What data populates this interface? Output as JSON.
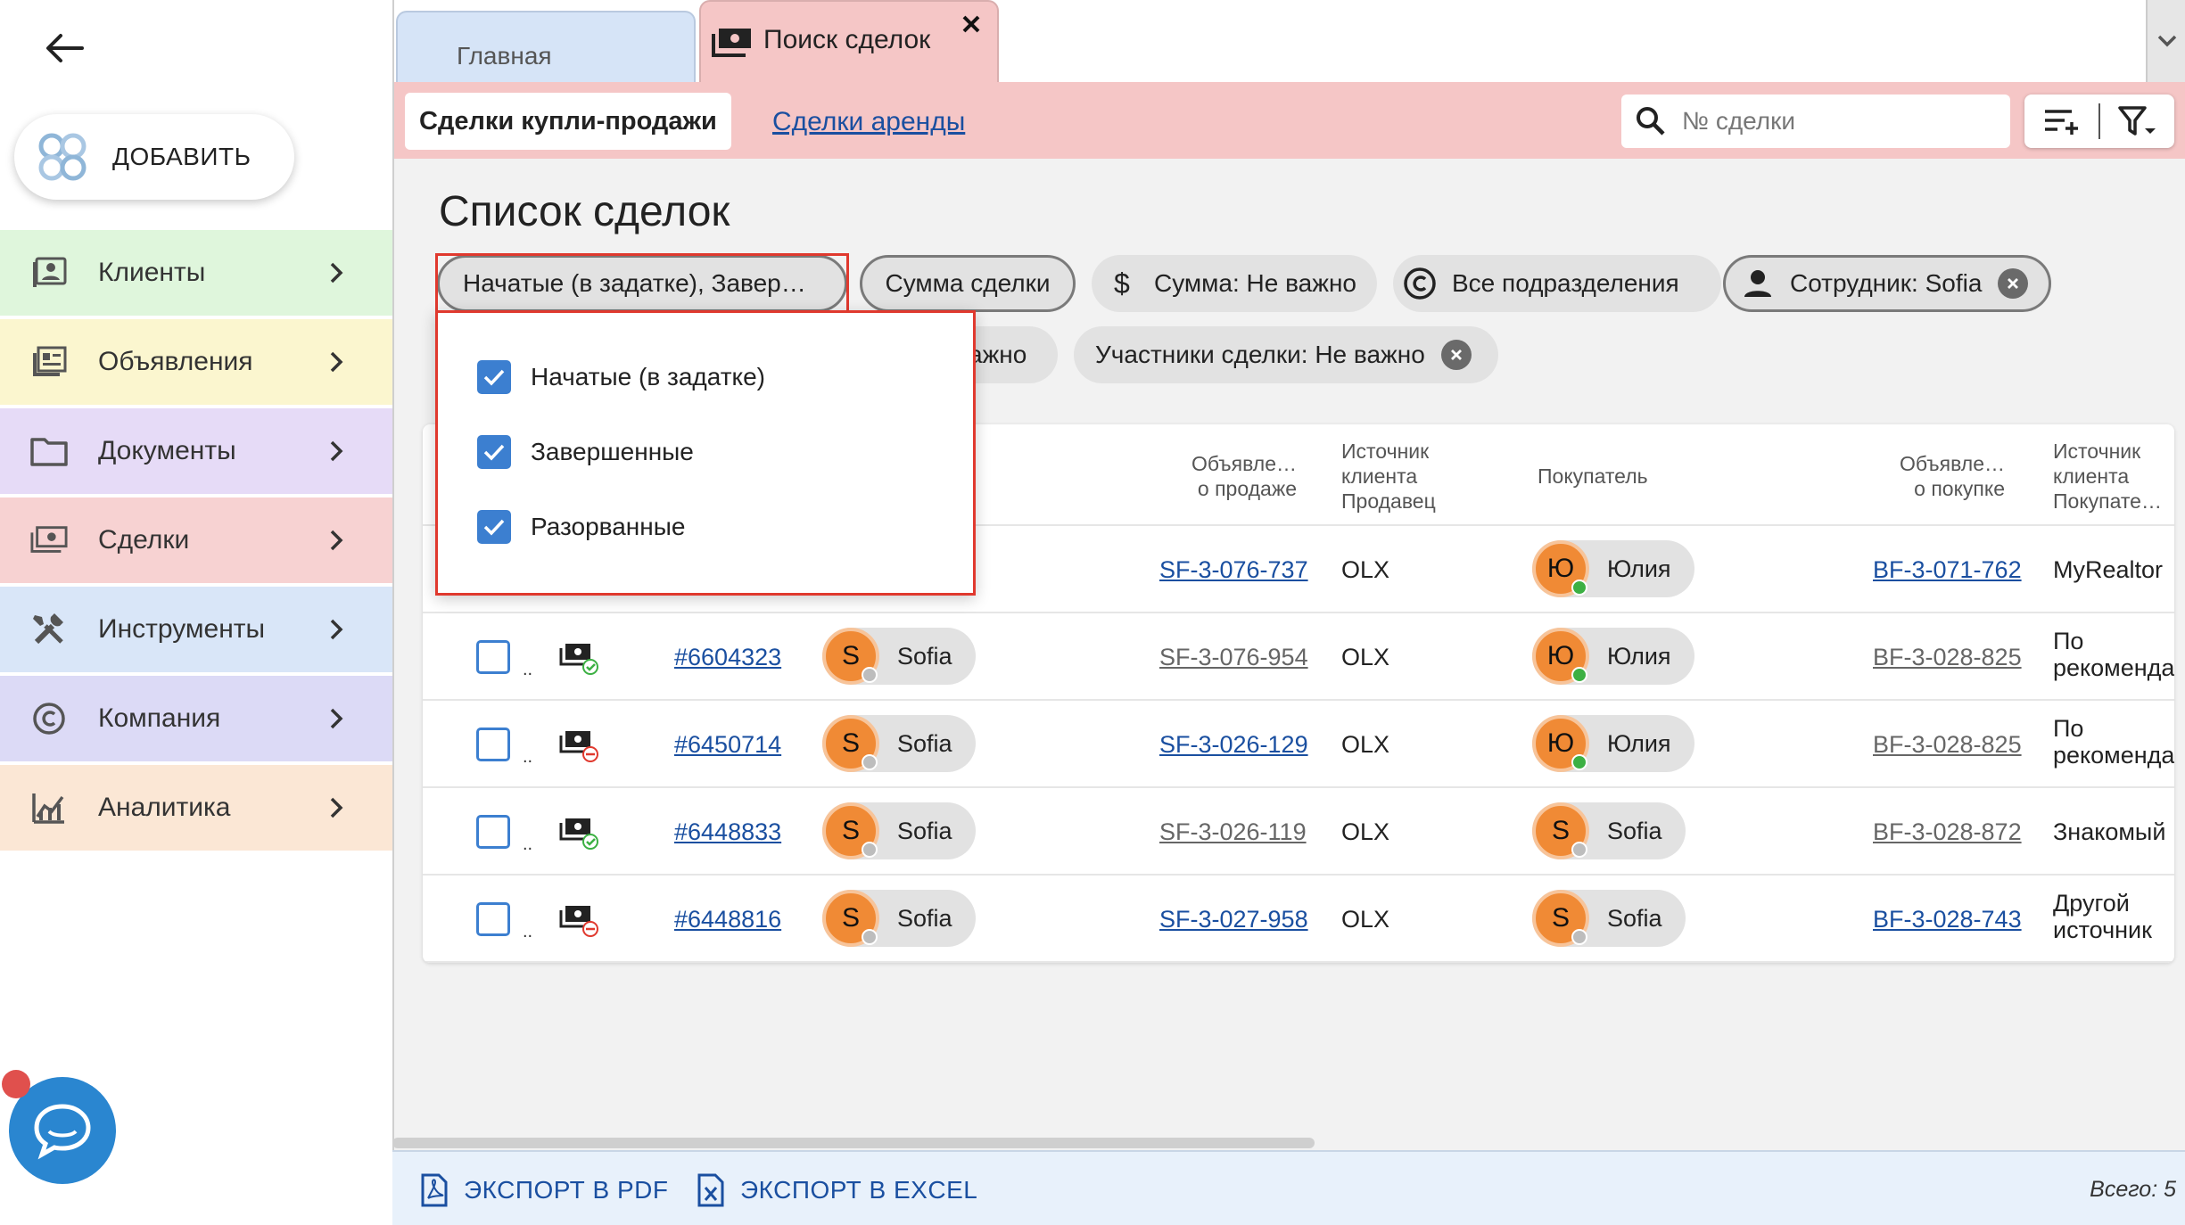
{
  "sidebar": {
    "add_label": "ДОБАВИТЬ",
    "items": [
      {
        "label": "Клиенты",
        "icon": "contacts-icon",
        "color": "#dff6dc"
      },
      {
        "label": "Объявления",
        "icon": "listings-icon",
        "color": "#fbf6cf"
      },
      {
        "label": "Документы",
        "icon": "folder-icon",
        "color": "#e6dbf7"
      },
      {
        "label": "Сделки",
        "icon": "money-icon",
        "color": "#f7d2d2"
      },
      {
        "label": "Инструменты",
        "icon": "tools-icon",
        "color": "#d9e6f8"
      },
      {
        "label": "Компания",
        "icon": "copyright-icon",
        "color": "#dcdaf6"
      },
      {
        "label": "Аналитика",
        "icon": "analytics-icon",
        "color": "#fbe7d5"
      }
    ]
  },
  "tabs": {
    "home": "Главная",
    "search": "Поиск сделок"
  },
  "subbar": {
    "active": "Сделки купли-продажи",
    "link": "Сделки аренды",
    "search_placeholder": "№ сделки"
  },
  "page_title": "Список сделок",
  "chips": {
    "status": "Начатые (в задатке), Завер…",
    "sum_deal": "Сумма сделки",
    "sum": "Сумма: Не важно",
    "departments": "Все подразделения",
    "employee": "Сотрудник: Sofia",
    "hidden_partial": "ажно",
    "participants": "Участники сделки: Не важно"
  },
  "dropdown": {
    "items": [
      "Начатые (в задатке)",
      "Завершенные",
      "Разорванные"
    ]
  },
  "table": {
    "headers": {
      "listing_sale": [
        "Объявле…",
        "о продаже"
      ],
      "source_seller": [
        "Источник",
        "клиента",
        "Продавец"
      ],
      "buyer": "Покупатель",
      "listing_buy": [
        "Объявле…",
        "о покупке"
      ],
      "source_buyer": [
        "Источник",
        "клиента",
        "Покупате…"
      ]
    },
    "rows": [
      {
        "id": "",
        "status": "",
        "agent": "",
        "listing_sale": "SF-3-076-737",
        "listing_sale_style": "blue",
        "source_seller": "OLX",
        "buyer_initial": "Ю",
        "buyer": "Юлия",
        "listing_buy": "BF-3-071-762",
        "listing_buy_style": "blue",
        "source_buyer": [
          "MyRealtor"
        ]
      },
      {
        "id": "#6604323",
        "status": "done",
        "agent": "Sofia",
        "listing_sale": "SF-3-076-954",
        "listing_sale_style": "gray",
        "source_seller": "OLX",
        "buyer_initial": "Ю",
        "buyer": "Юлия",
        "listing_buy": "BF-3-028-825",
        "listing_buy_style": "gray",
        "source_buyer": [
          "По",
          "рекомендац"
        ]
      },
      {
        "id": "#6450714",
        "status": "broken",
        "agent": "Sofia",
        "listing_sale": "SF-3-026-129",
        "listing_sale_style": "blue",
        "source_seller": "OLX",
        "buyer_initial": "Ю",
        "buyer": "Юлия",
        "listing_buy": "BF-3-028-825",
        "listing_buy_style": "gray",
        "source_buyer": [
          "По",
          "рекомендац"
        ]
      },
      {
        "id": "#6448833",
        "status": "done",
        "agent": "Sofia",
        "listing_sale": "SF-3-026-119",
        "listing_sale_style": "gray",
        "source_seller": "OLX",
        "buyer_initial": "S",
        "buyer": "Sofia",
        "listing_buy": "BF-3-028-872",
        "listing_buy_style": "gray",
        "source_buyer": [
          "Знакомый"
        ]
      },
      {
        "id": "#6448816",
        "status": "broken",
        "agent": "Sofia",
        "listing_sale": "SF-3-027-958",
        "listing_sale_style": "blue",
        "source_seller": "OLX",
        "buyer_initial": "S",
        "buyer": "Sofia",
        "listing_buy": "BF-3-028-743",
        "listing_buy_style": "blue",
        "source_buyer": [
          "Другой",
          "источник"
        ]
      }
    ]
  },
  "footer": {
    "export_pdf": "ЭКСПОРТ В PDF",
    "export_excel": "ЭКСПОРТ В EXCEL",
    "total": "Всего: 5"
  },
  "colors": {
    "accent_blue": "#1a4fa0",
    "checkbox_blue": "#3c7fd0",
    "avatar_orange": "#f08a35",
    "highlight_red": "#e0392e",
    "online_green": "#3cb043"
  }
}
